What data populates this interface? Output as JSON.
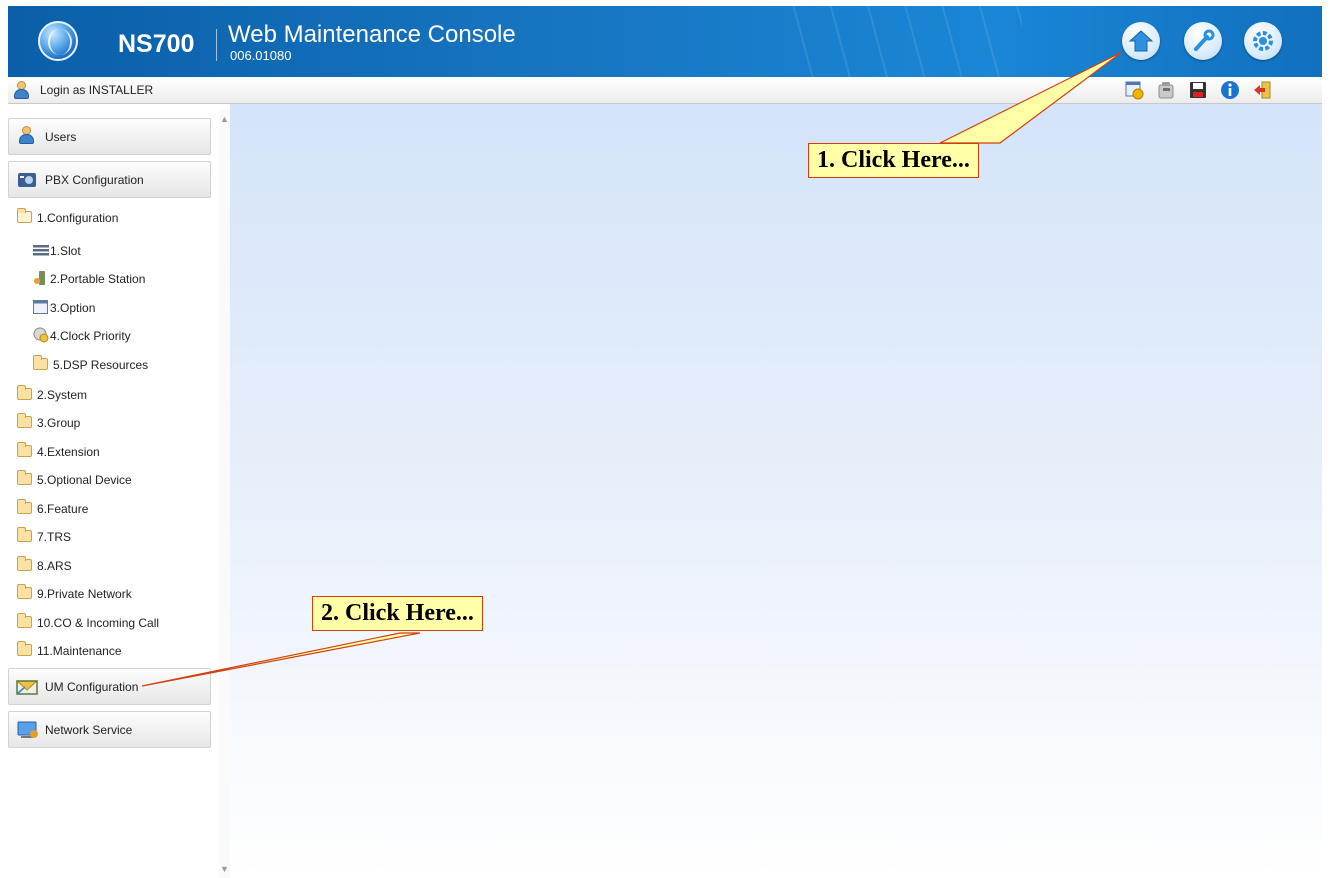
{
  "header": {
    "model": "NS700",
    "title": "Web Maintenance Console",
    "version": "006.01080",
    "buttons": [
      "home-icon",
      "wrench-icon",
      "gear-icon"
    ]
  },
  "toolbar": {
    "login_text": "Login as INSTALLER",
    "icons": [
      "system-status-icon",
      "phone-icon",
      "save-icon",
      "info-icon",
      "logout-icon"
    ]
  },
  "sidebar": {
    "sections": {
      "users": "Users",
      "pbx": "PBX Configuration",
      "um": "UM Configuration",
      "network": "Network Service"
    },
    "config_folder": "1.Configuration",
    "config_items": [
      "1.Slot",
      "2.Portable Station",
      "3.Option",
      "4.Clock Priority",
      "5.DSP Resources"
    ],
    "folders": [
      "2.System",
      "3.Group",
      "4.Extension",
      "5.Optional Device",
      "6.Feature",
      "7.TRS",
      "8.ARS",
      "9.Private Network",
      "10.CO & Incoming Call",
      "11.Maintenance"
    ]
  },
  "annotations": {
    "step1": "1. Click Here...",
    "step2": "2. Click Here..."
  },
  "colors": {
    "header_blue": "#1774c0",
    "callout_bg": "#ffffa8",
    "callout_border": "#d04010"
  }
}
